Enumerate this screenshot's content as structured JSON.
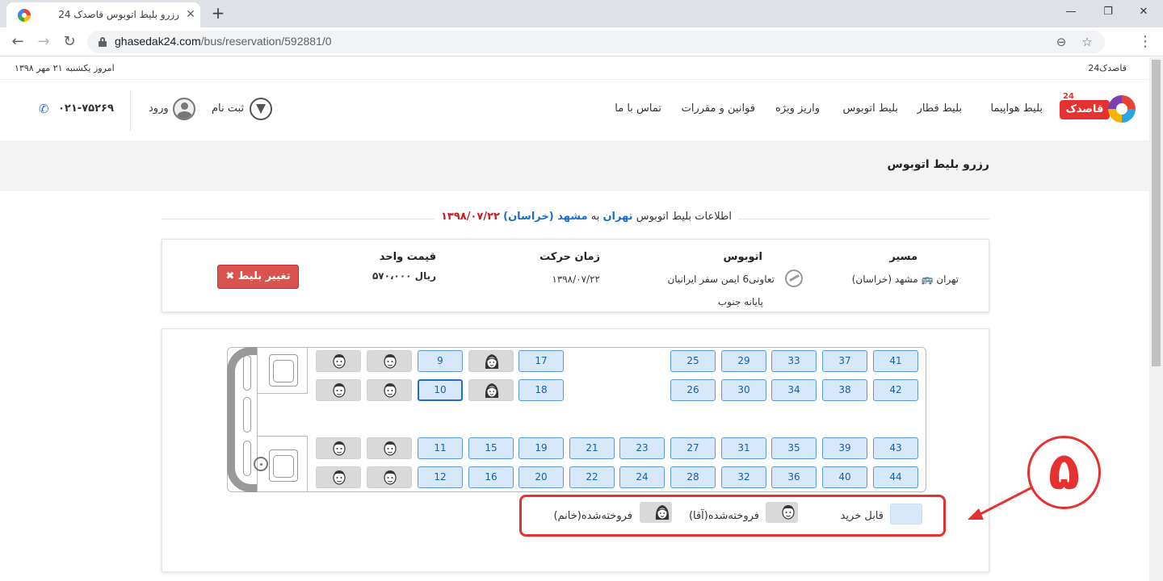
{
  "browser": {
    "tab_title": "رزرو بلیط اتوبوس قاصدک 24 |",
    "url_domain": "ghasedak24.com",
    "url_path": "/bus/reservation/592881/0",
    "new_tab": "+",
    "tab_close": "✕",
    "minimize": "—",
    "restore": "❐",
    "close": "✕",
    "back": "←",
    "forward": "→",
    "reload": "↻",
    "zoom": "⊖",
    "star": "☆",
    "menu": "⋮"
  },
  "topstrip": {
    "date": "امروز یکشنبه ۲۱ مهر ۱۳۹۸",
    "brand": "قاصدک24"
  },
  "header": {
    "logo_text": "قاصدک",
    "logo_number": "24",
    "nav": {
      "flight": "بلیط هواپیما",
      "train": "بلیط قطار",
      "bus": "بلیط اتوبوس",
      "deposit": "واریز ویژه",
      "rules": "قوانین و مقررات",
      "contact": "تماس با ما"
    },
    "register": "ثبت نام",
    "login": "ورود",
    "phone": "۰۲۱-۷۵۲۶۹",
    "phone_icon": "✆"
  },
  "page": {
    "title": "رزرو بلیط اتوبوس"
  },
  "info": {
    "prefix": "اطلاعات بلیط اتوبوس",
    "origin": "تهران",
    "to": "به",
    "destination": "مشهد (خراسان)",
    "date": "۱۳۹۸/۰۷/۲۲"
  },
  "trip": {
    "route_label": "مسیر",
    "route_value": "تهران 🚌 مشهد (خراسان)",
    "bus_label": "اتوبوس",
    "bus_company": "تعاونی6 ایمن سفر ایرانیان",
    "terminal": "پایانه جنوب",
    "time_label": "زمان حرکت",
    "time_value": "۱۳۹۸/۰۷/۲۲",
    "price_label": "قیمت واحد",
    "price_value": "۵۷۰،۰۰۰ ریال",
    "change_button": "✖ تغییر بلیط"
  },
  "seats": {
    "row1": [
      "M",
      "M",
      "9",
      "F",
      "17",
      "",
      "25",
      "29",
      "33",
      "37",
      "41"
    ],
    "row2": [
      "M",
      "M",
      "10",
      "F",
      "18",
      "",
      "26",
      "30",
      "34",
      "38",
      "42"
    ],
    "row3": [
      "M",
      "M",
      "11",
      "15",
      "19",
      "21",
      "23",
      "27",
      "31",
      "35",
      "39",
      "43"
    ],
    "row4": [
      "M",
      "M",
      "12",
      "16",
      "20",
      "22",
      "24",
      "28",
      "32",
      "36",
      "40",
      "44"
    ],
    "selected": "10"
  },
  "legend": {
    "available": "قابل خرید",
    "sold_male": "فروخته‌شده(آقا)",
    "sold_female": "فروخته‌شده(خانم)"
  },
  "annotation": {
    "number": "۵"
  },
  "colors": {
    "accent_red": "#e5312f",
    "seat_available": "#d6e8fa",
    "seat_border": "#5b9bd5",
    "seat_sold": "#d9d9d9",
    "link_blue": "#1a6fc4"
  }
}
